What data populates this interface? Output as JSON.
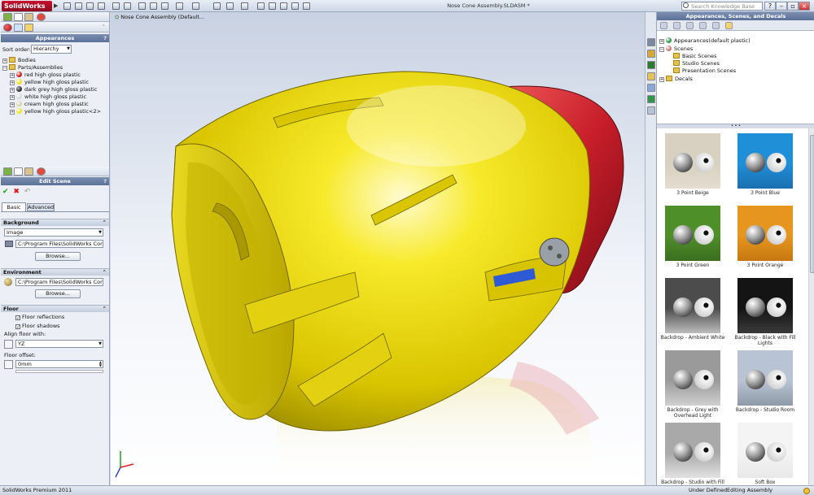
{
  "app": {
    "logo": "SolidWorks",
    "document_title": "Nose Cone Assembly.SLDASM *"
  },
  "search": {
    "placeholder": "Search Knowledge Base"
  },
  "appearances_panel": {
    "title": "Appearances",
    "sort_label": "Sort order:",
    "sort_value": "Hierarchy",
    "tree": [
      {
        "label": "Bodies",
        "level": 0
      },
      {
        "label": "Parts/Assemblies",
        "level": 0
      },
      {
        "label": "red high gloss plastic",
        "level": 1,
        "color": "#d21a1a"
      },
      {
        "label": "yellow high gloss plastic",
        "level": 1,
        "color": "#f2e21a"
      },
      {
        "label": "dark grey high gloss plastic",
        "level": 1,
        "color": "#333333"
      },
      {
        "label": "white high gloss plastic",
        "level": 1,
        "color": "#f4f4f4"
      },
      {
        "label": "cream high gloss plastic",
        "level": 1,
        "color": "#e8e2c8"
      },
      {
        "label": "yellow high gloss plastic<2>",
        "level": 1,
        "color": "#f2e21a"
      }
    ]
  },
  "edit_scene": {
    "title": "Edit Scene",
    "tabs": [
      "Basic",
      "Advanced"
    ],
    "background": {
      "title": "Background",
      "type": "Image",
      "path": "C:\\Program Files\\SolidWorks Corp\\SolidW",
      "browse": "Browse..."
    },
    "environment": {
      "title": "Environment",
      "path": "C:\\Program Files\\SolidWorks Corp\\SolidW",
      "browse": "Browse..."
    },
    "floor": {
      "title": "Floor",
      "reflections": "Floor reflections",
      "shadows": "Floor shadows",
      "align_label": "Align floor with:",
      "align_value": "YZ",
      "offset_label": "Floor offset:",
      "offset_value": "0mm"
    }
  },
  "viewport": {
    "breadcrumb": "Nose Cone Assembly  (Default..."
  },
  "right_pane": {
    "title": "Appearances, Scenes, and Decals",
    "tree": [
      {
        "label": "Appearances(default plastic)",
        "level": 0
      },
      {
        "label": "Scenes",
        "level": 0
      },
      {
        "label": "Basic Scenes",
        "level": 1
      },
      {
        "label": "Studio Scenes",
        "level": 1
      },
      {
        "label": "Presentation Scenes",
        "level": 1
      },
      {
        "label": "Decals",
        "level": 0
      }
    ],
    "scenes": [
      {
        "label": "3 Point Beige",
        "bg": "#d8d0c0",
        "floor": "#e4ddd0"
      },
      {
        "label": "3 Point Blue",
        "bg": "#1f8fd8",
        "floor": "#1a6fb0"
      },
      {
        "label": "3 Point Green",
        "bg": "#4e8f2a",
        "floor": "#3b6e1f"
      },
      {
        "label": "3 Point Orange",
        "bg": "#e6961e",
        "floor": "#c57810"
      },
      {
        "label": "Backdrop - Ambient White",
        "bg": "#4c4c4c",
        "floor": "#bdbdbd"
      },
      {
        "label": "Backdrop - Black with Fill Lights",
        "bg": "#141414",
        "floor": "#3a3a3a"
      },
      {
        "label": "Backdrop - Grey with Overhead Light",
        "bg": "#9a9a9a",
        "floor": "#d0d0d0"
      },
      {
        "label": "Backdrop - Studio Room",
        "bg": "#b8c4d4",
        "floor": "#8f9aa8"
      },
      {
        "label": "Backdrop - Studio with Fill Lights",
        "bg": "#a9a9a9",
        "floor": "#e2e2e2"
      },
      {
        "label": "Soft Box",
        "bg": "#f4f4f4",
        "floor": "#e8e8e8"
      }
    ]
  },
  "status": {
    "edition": "SolidWorks Premium 2011",
    "state": "Under Defined",
    "mode": "Editing Assembly"
  }
}
